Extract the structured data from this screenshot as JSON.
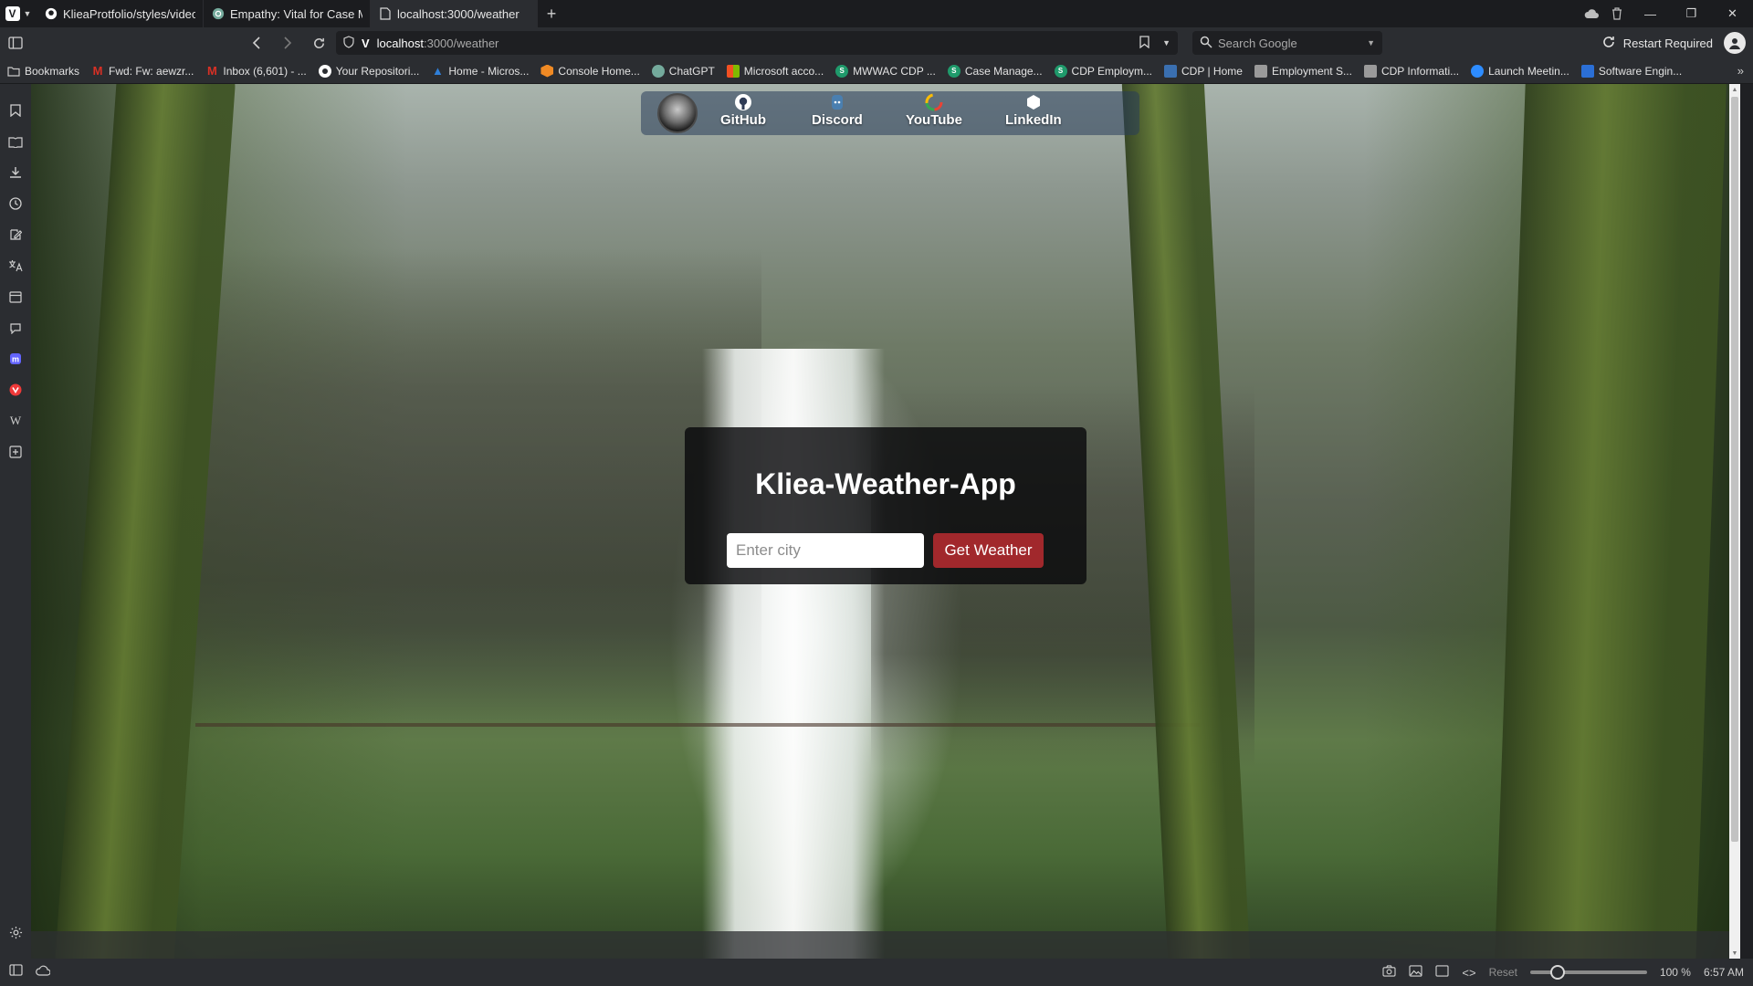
{
  "browser": {
    "tabs": [
      {
        "label": "KlieaProtfolio/styles/video.r",
        "icon": "github-icon",
        "active": false
      },
      {
        "label": "Empathy: Vital for Case Ma",
        "icon": "chatgpt-icon",
        "active": false
      },
      {
        "label": "localhost:3000/weather",
        "icon": "page-icon",
        "active": true
      }
    ],
    "address": {
      "host": "localhost",
      "path": ":3000/weather"
    },
    "search": {
      "placeholder": "Search Google"
    },
    "restart_label": "Restart Required",
    "bookmarks": [
      {
        "label": "Bookmarks",
        "icon": "folder-icon",
        "color": "#c9c9c9"
      },
      {
        "label": "Fwd: Fw: aewzr...",
        "icon": "gmail-icon",
        "color": "#d93025"
      },
      {
        "label": "Inbox (6,601) - ...",
        "icon": "gmail-icon",
        "color": "#d93025"
      },
      {
        "label": "Your Repositori...",
        "icon": "github-icon",
        "color": "#ffffff"
      },
      {
        "label": "Home - Micros...",
        "icon": "azure-icon",
        "color": "#2f7fd8"
      },
      {
        "label": "Console Home...",
        "icon": "aws-icon",
        "color": "#f08a24"
      },
      {
        "label": "ChatGPT",
        "icon": "chatgpt-icon",
        "color": "#74aa9c"
      },
      {
        "label": "Microsoft acco...",
        "icon": "microsoft-icon",
        "color": "#f25022"
      },
      {
        "label": "MWWAC CDP ...",
        "icon": "s-icon",
        "color": "#1f9a6b"
      },
      {
        "label": "Case Manage...",
        "icon": "s-icon",
        "color": "#1f9a6b"
      },
      {
        "label": "CDP Employm...",
        "icon": "s-icon",
        "color": "#1f9a6b"
      },
      {
        "label": "CDP | Home",
        "icon": "cdp-icon",
        "color": "#3a6fb0"
      },
      {
        "label": "Employment S...",
        "icon": "page-icon",
        "color": "#9a9a9a"
      },
      {
        "label": "CDP Informati...",
        "icon": "page-icon",
        "color": "#9a9a9a"
      },
      {
        "label": "Launch Meetin...",
        "icon": "zoom-icon",
        "color": "#2d8cff"
      },
      {
        "label": "Software Engin...",
        "icon": "person-icon",
        "color": "#2b6fd6"
      }
    ],
    "status": {
      "reset_label": "Reset",
      "zoom": "100 %",
      "zoom_level": 1.0,
      "time": "6:57 AM"
    }
  },
  "page": {
    "social_links": [
      {
        "label": "GitHub",
        "icon": "github-icon"
      },
      {
        "label": "Discord",
        "icon": "discord-icon"
      },
      {
        "label": "YouTube",
        "icon": "youtube-icon"
      },
      {
        "label": "LinkedIn",
        "icon": "linkedin-icon"
      }
    ],
    "app_title": "Kliea-Weather-App",
    "city_input": {
      "value": "",
      "placeholder": "Enter city"
    },
    "get_weather_label": "Get Weather",
    "colors": {
      "button": "#a1282c",
      "card": "rgba(10,10,12,0.82)"
    }
  }
}
